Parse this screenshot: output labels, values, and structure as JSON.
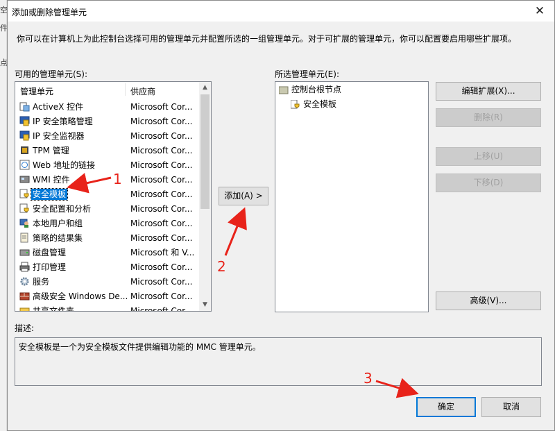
{
  "background": {
    "fragments": [
      "空",
      "件",
      "点"
    ]
  },
  "dialog": {
    "title": "添加或删除管理单元",
    "close_glyph": "✕",
    "intro": "你可以在计算机上为此控制台选择可用的管理单元并配置所选的一组管理单元。对于可扩展的管理单元，你可以配置要启用哪些扩展项。"
  },
  "available": {
    "label": "可用的管理单元(S):",
    "columns": [
      "管理单元",
      "供应商"
    ],
    "items": [
      {
        "name": "ActiveX 控件",
        "vendor": "Microsoft Cor...",
        "icon": "activex-icon"
      },
      {
        "name": "IP 安全策略管理",
        "vendor": "Microsoft Cor...",
        "icon": "ip-policy-icon"
      },
      {
        "name": "IP 安全监视器",
        "vendor": "Microsoft Cor...",
        "icon": "ip-monitor-icon"
      },
      {
        "name": "TPM 管理",
        "vendor": "Microsoft Cor...",
        "icon": "tpm-icon"
      },
      {
        "name": "Web 地址的链接",
        "vendor": "Microsoft Cor...",
        "icon": "web-link-icon"
      },
      {
        "name": "WMI 控件",
        "vendor": "Microsoft Cor...",
        "icon": "wmi-icon"
      },
      {
        "name": "安全模板",
        "vendor": "Microsoft Cor...",
        "icon": "security-template-icon"
      },
      {
        "name": "安全配置和分析",
        "vendor": "Microsoft Cor...",
        "icon": "security-config-icon"
      },
      {
        "name": "本地用户和组",
        "vendor": "Microsoft Cor...",
        "icon": "local-users-icon"
      },
      {
        "name": "策略的结果集",
        "vendor": "Microsoft Cor...",
        "icon": "rsop-icon"
      },
      {
        "name": "磁盘管理",
        "vendor": "Microsoft 和 V...",
        "icon": "disk-icon"
      },
      {
        "name": "打印管理",
        "vendor": "Microsoft Cor...",
        "icon": "print-icon"
      },
      {
        "name": "服务",
        "vendor": "Microsoft Cor...",
        "icon": "services-icon"
      },
      {
        "name": "高级安全 Windows De...",
        "vendor": "Microsoft Cor...",
        "icon": "firewall-icon"
      },
      {
        "name": "共享文件夹",
        "vendor": "Microsoft Cor...",
        "icon": "shared-folder-icon"
      }
    ],
    "selected_index": 6
  },
  "add_button": "添加(A) >",
  "selected": {
    "label": "所选管理单元(E):",
    "root": "控制台根节点",
    "child": "安全模板"
  },
  "right_buttons": {
    "edit_ext": "编辑扩展(X)...",
    "remove": "删除(R)",
    "move_up": "上移(U)",
    "move_down": "下移(D)",
    "advanced": "高级(V)..."
  },
  "description": {
    "label": "描述:",
    "text": "安全模板是一个为安全模板文件提供编辑功能的 MMC 管理单元。"
  },
  "footer": {
    "ok": "确定",
    "cancel": "取消"
  },
  "annotations": [
    "1",
    "2",
    "3"
  ],
  "colors": {
    "selection": "#0078d7",
    "annotation": "#e8231a"
  }
}
